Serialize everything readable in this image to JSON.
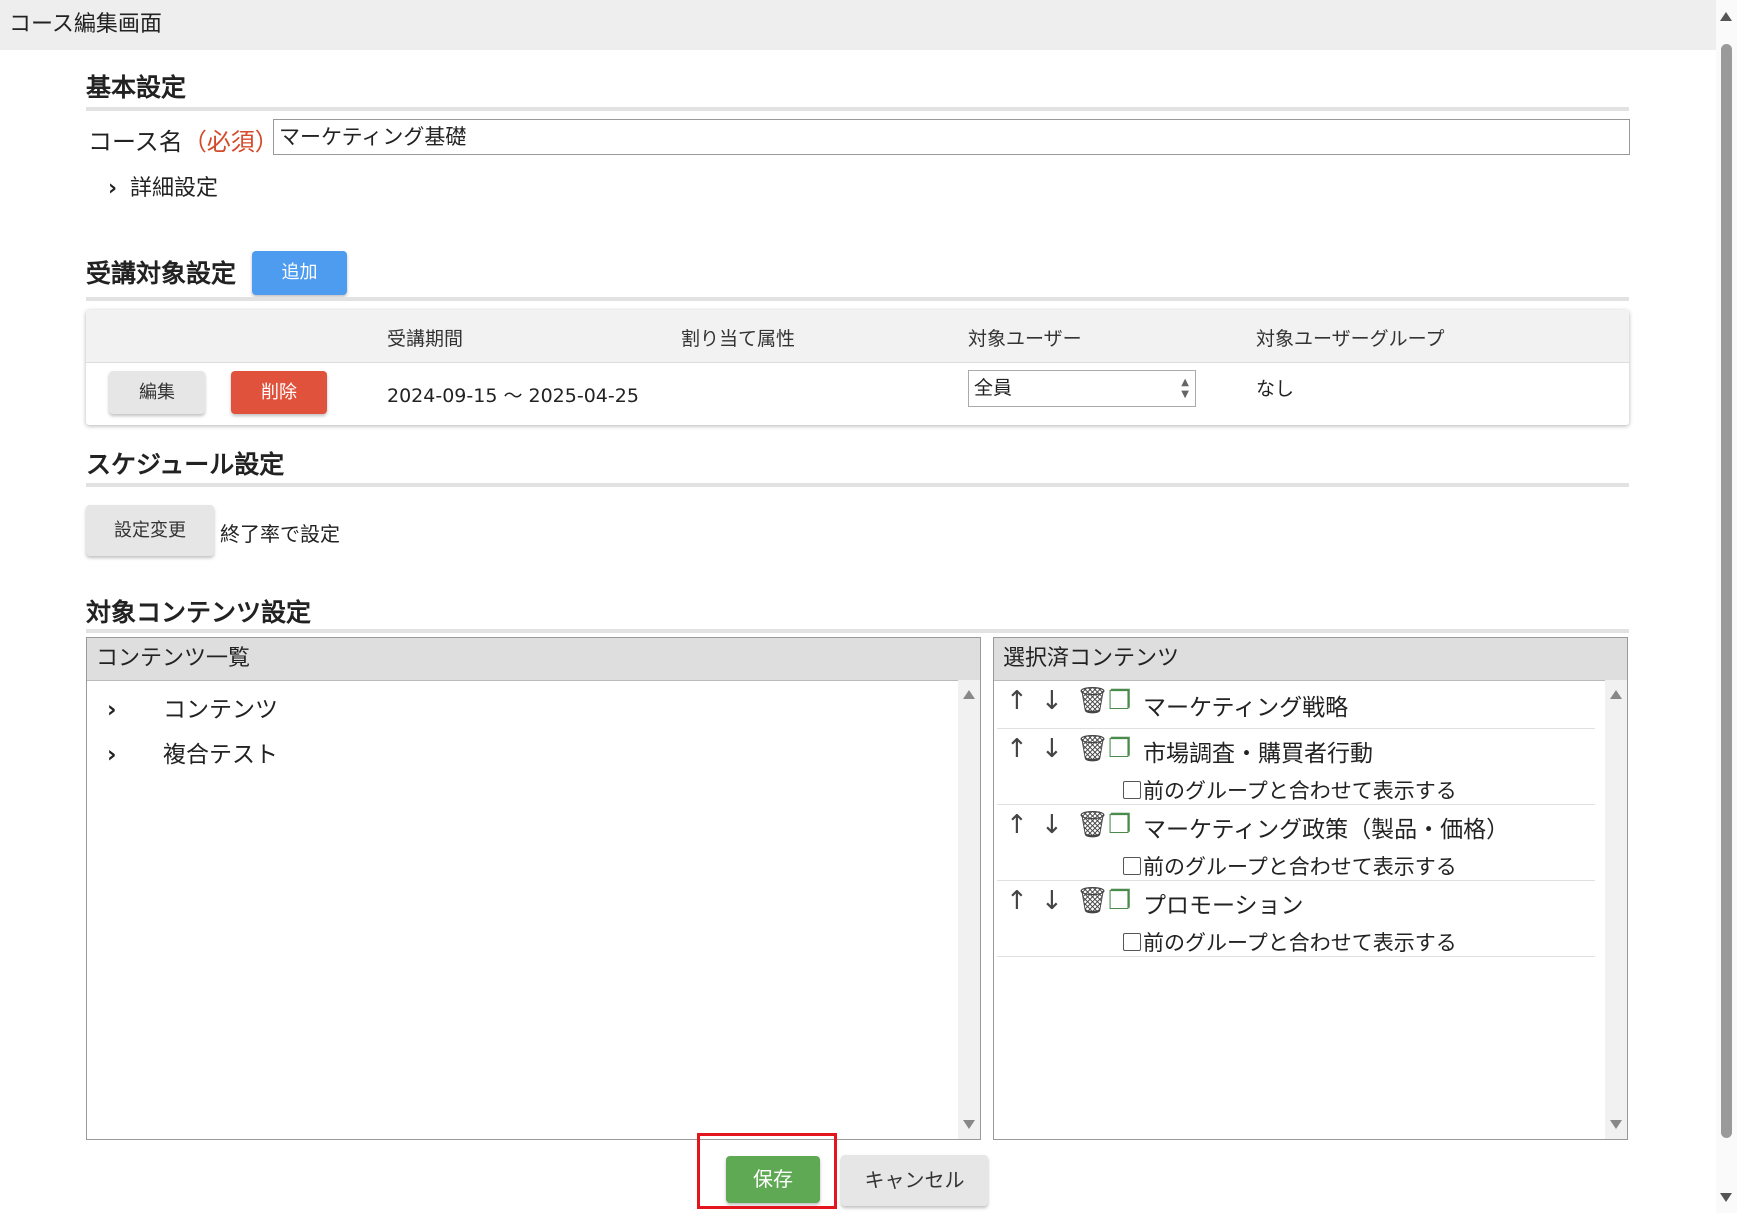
{
  "window": {
    "title": "コース編集画面"
  },
  "basic": {
    "heading": "基本設定",
    "course_name_label": "コース名",
    "required_label": "（必須）",
    "course_name_value": "マーケティング基礎",
    "detail_toggle": "詳細設定"
  },
  "target": {
    "heading": "受講対象設定",
    "add_button": "追加",
    "columns": [
      "受講期間",
      "割り当て属性",
      "対象ユーザー",
      "対象ユーザーグループ"
    ],
    "row": {
      "edit_button": "編集",
      "delete_button": "削除",
      "period": "2024-09-15 〜 2025-04-25",
      "attribute": "",
      "user_select_value": "全員",
      "user_group": "なし"
    }
  },
  "schedule": {
    "heading": "スケジュール設定",
    "change_button": "設定変更",
    "status_text": "終了率で設定"
  },
  "contents": {
    "heading": "対象コンテンツ設定",
    "list_panel_title": "コンテンツ一覧",
    "list_items": [
      "コンテンツ",
      "複合テスト"
    ],
    "selected_panel_title": "選択済コンテンツ",
    "combine_label": "前のグループと合わせて表示する",
    "selected_items": [
      {
        "title": "マーケティング戦略"
      },
      {
        "title": "市場調査・購買者行動"
      },
      {
        "title": "マーケティング政策（製品・価格）"
      },
      {
        "title": "プロモーション"
      }
    ]
  },
  "footer": {
    "save_button": "保存",
    "cancel_button": "キャンセル"
  },
  "colors": {
    "accent_blue": "#4e9cef",
    "danger_red": "#e0523c",
    "save_green": "#5fa854",
    "highlight_box": "#e3161d",
    "required_text": "#d44a2a"
  }
}
